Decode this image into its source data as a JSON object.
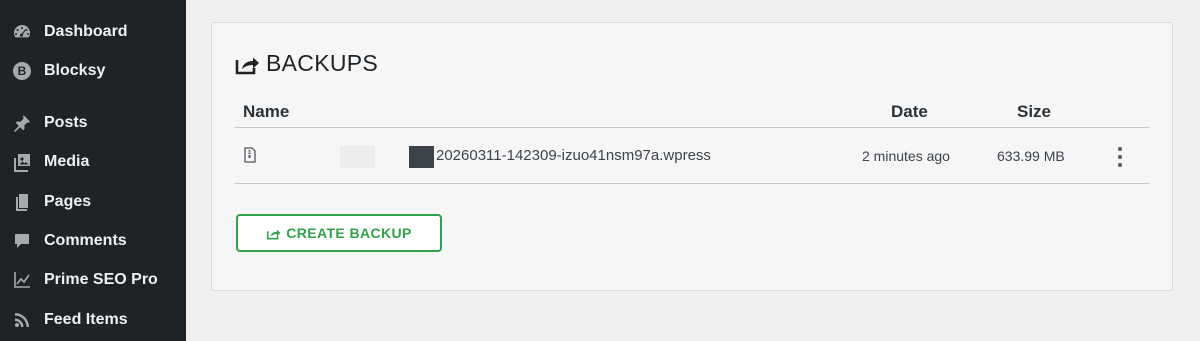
{
  "sidebar": {
    "items": [
      {
        "label": "Dashboard",
        "icon": "dashboard-icon"
      },
      {
        "label": "Blocksy",
        "icon": "blocksy-logo-icon"
      },
      {
        "label": "Posts",
        "icon": "pushpin-icon"
      },
      {
        "label": "Media",
        "icon": "media-icon"
      },
      {
        "label": "Pages",
        "icon": "pages-icon"
      },
      {
        "label": "Comments",
        "icon": "comment-bubble-icon"
      },
      {
        "label": "Prime SEO Pro",
        "icon": "line-chart-icon"
      },
      {
        "label": "Feed Items",
        "icon": "rss-icon"
      }
    ]
  },
  "backups": {
    "title": "BACKUPS",
    "title_icon": "export-icon",
    "columns": {
      "name": "Name",
      "date": "Date",
      "size": "Size"
    },
    "rows": [
      {
        "filename": "20260311-142309-izuo41nsm97a.wpress",
        "date": "2 minutes ago",
        "size": "633.99 MB"
      }
    ],
    "create_button": {
      "label": "CREATE BACKUP",
      "icon": "export-icon"
    }
  },
  "colors": {
    "sidebar_bg": "#1d2327",
    "page_bg": "#f0f0f1",
    "accent_green": "#2fa34a"
  }
}
